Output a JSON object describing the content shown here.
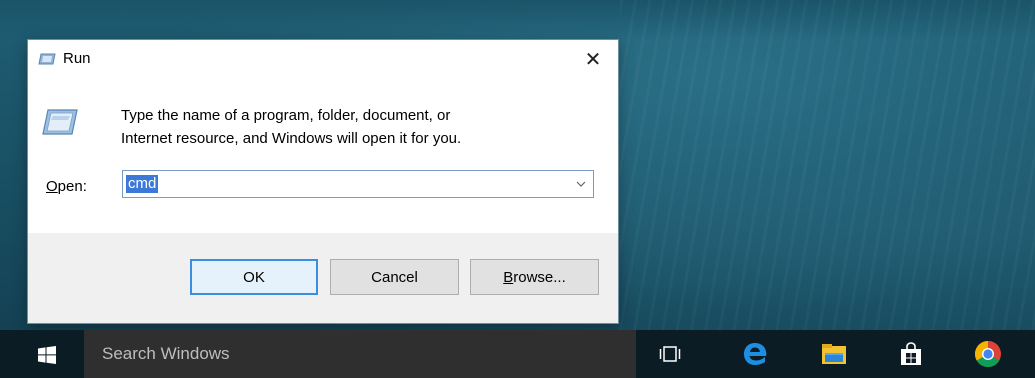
{
  "run_dialog": {
    "title": "Run",
    "close_glyph": "✕",
    "description_line1": "Type the name of a program, folder, document, or",
    "description_line2": "Internet resource, and Windows will open it for you.",
    "open_label_underlined": "O",
    "open_label_rest": "pen:",
    "open_value": "cmd",
    "dropdown_glyph": "⌄",
    "ok_label": "OK",
    "cancel_label": "Cancel",
    "browse_label_underlined": "B",
    "browse_label_rest": "rowse...",
    "icon": "run-icon"
  },
  "taskbar": {
    "start_icon": "windows-logo-icon",
    "search_placeholder": "Search Windows",
    "task_view_icon": "task-view-icon",
    "edge_icon": "edge-icon",
    "file_explorer_icon": "file-explorer-icon",
    "store_icon": "store-icon",
    "chrome_icon": "chrome-icon"
  },
  "colors": {
    "selection": "#3b78d8",
    "ok_border": "#3a8ee0",
    "taskbar": "#0c1c24",
    "search_box": "#2f2f2f"
  }
}
